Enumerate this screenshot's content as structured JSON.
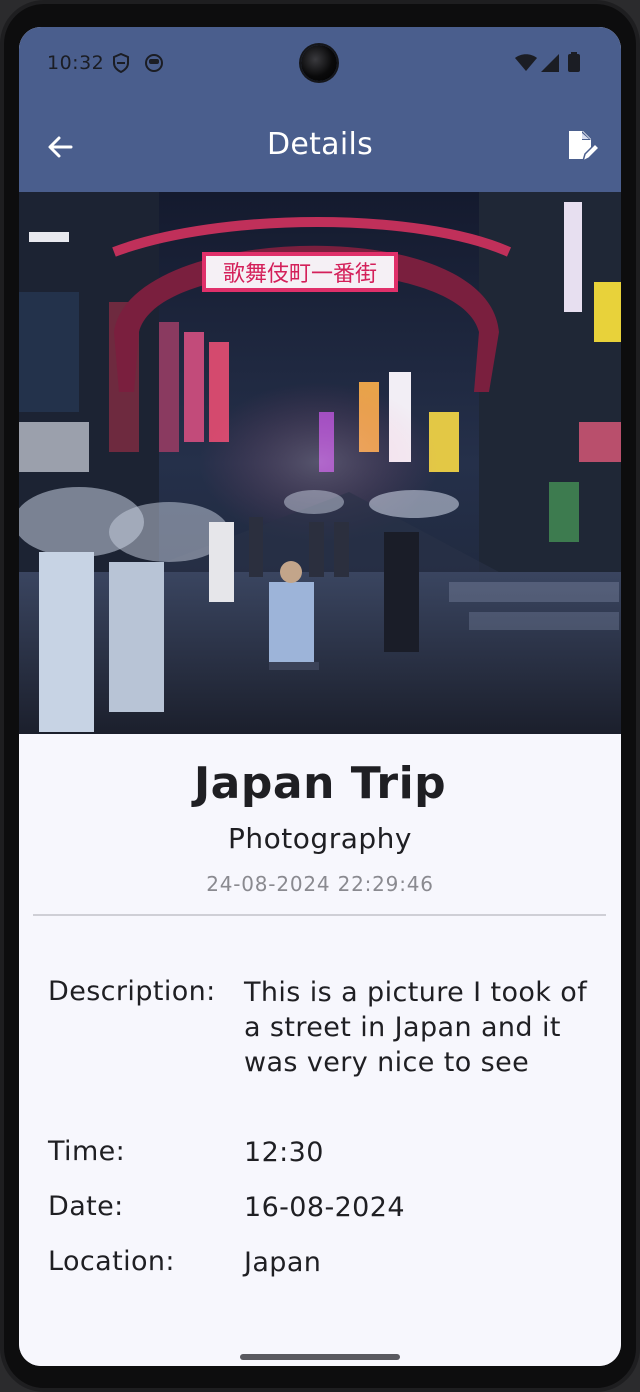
{
  "status_bar": {
    "time": "10:32",
    "icons": [
      "shield-icon",
      "face-icon",
      "wifi-icon",
      "signal-icon",
      "battery-icon"
    ]
  },
  "appbar": {
    "title": "Details",
    "background": "#4a5e8d",
    "back_icon": "arrow-left-icon",
    "edit_icon": "edit-document-icon"
  },
  "hero": {
    "sign_text": "歌舞伎町一番街"
  },
  "entry": {
    "title": "Japan Trip",
    "category": "Photography",
    "timestamp": "24-08-2024 22:29:46"
  },
  "details": [
    {
      "label": "Description:",
      "value": "This is a picture I took of a street in Japan and it was very nice to see"
    },
    {
      "label": "Time:",
      "value": "12:30"
    },
    {
      "label": "Date:",
      "value": "16-08-2024"
    },
    {
      "label": "Location:",
      "value": "Japan"
    }
  ]
}
